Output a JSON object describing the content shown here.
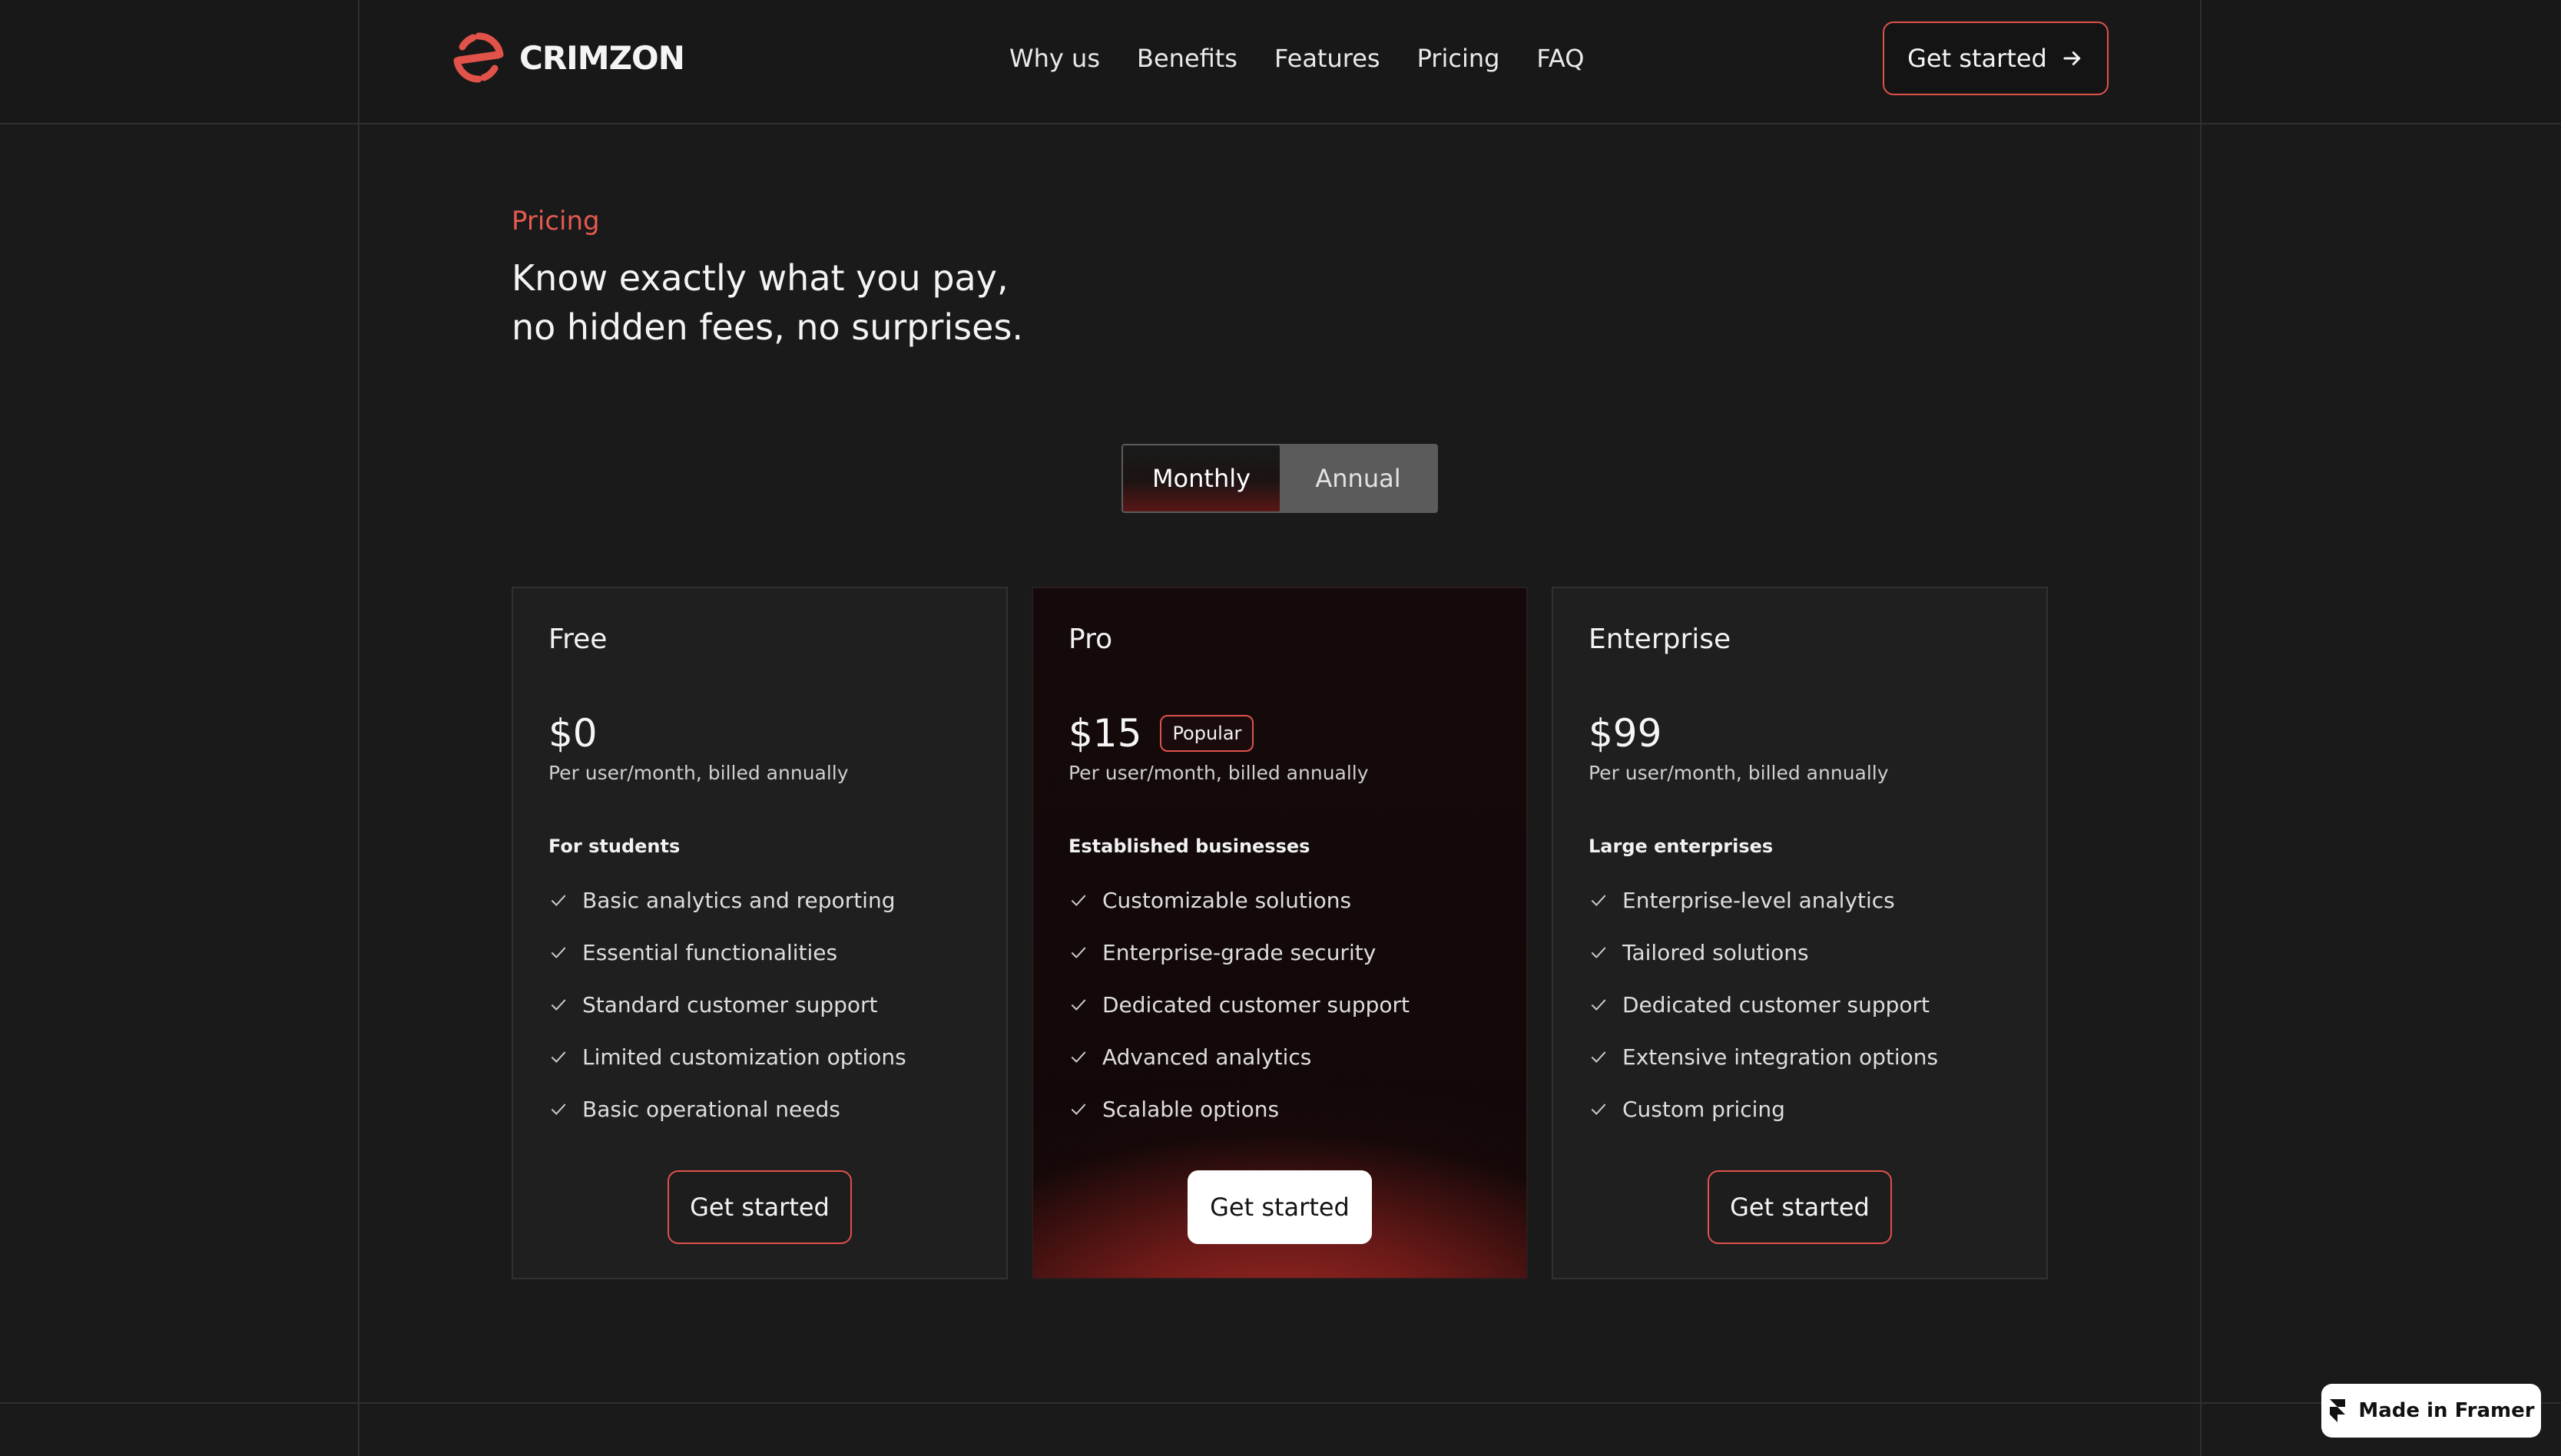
{
  "brand": {
    "name": "CRIMZON",
    "accent": "#e0524a"
  },
  "nav": {
    "items": [
      {
        "label": "Why us"
      },
      {
        "label": "Benefits"
      },
      {
        "label": "Features"
      },
      {
        "label": "Pricing"
      },
      {
        "label": "FAQ"
      }
    ],
    "cta": "Get started",
    "cta_icon": "arrow-right-icon"
  },
  "hero": {
    "eyebrow": "Pricing",
    "title_line1": "Know exactly what you pay,",
    "title_line2": "no hidden fees, no surprises."
  },
  "billing_toggle": {
    "options": [
      "Monthly",
      "Annual"
    ],
    "selected": "Monthly"
  },
  "plans": [
    {
      "name": "Free",
      "price": "$0",
      "badge": "",
      "billing": "Per user/month, billed annually",
      "audience": "For students",
      "features": [
        "Basic analytics and reporting",
        "Essential functionalities",
        "Standard customer support",
        "Limited customization options",
        "Basic operational needs"
      ],
      "cta": "Get started"
    },
    {
      "name": "Pro",
      "price": "$15",
      "badge": "Popular",
      "billing": "Per user/month, billed annually",
      "audience": "Established businesses",
      "features": [
        "Customizable solutions",
        "Enterprise-grade security",
        "Dedicated customer support",
        "Advanced analytics",
        "Scalable options"
      ],
      "cta": "Get started"
    },
    {
      "name": "Enterprise",
      "price": "$99",
      "badge": "",
      "billing": "Per user/month, billed annually",
      "audience": "Large enterprises",
      "features": [
        "Enterprise-level analytics",
        "Tailored solutions",
        "Dedicated customer support",
        "Extensive integration options",
        "Custom pricing"
      ],
      "cta": "Get started"
    }
  ],
  "framer_badge": {
    "label": "Made in Framer",
    "icon": "framer-logo-icon"
  }
}
